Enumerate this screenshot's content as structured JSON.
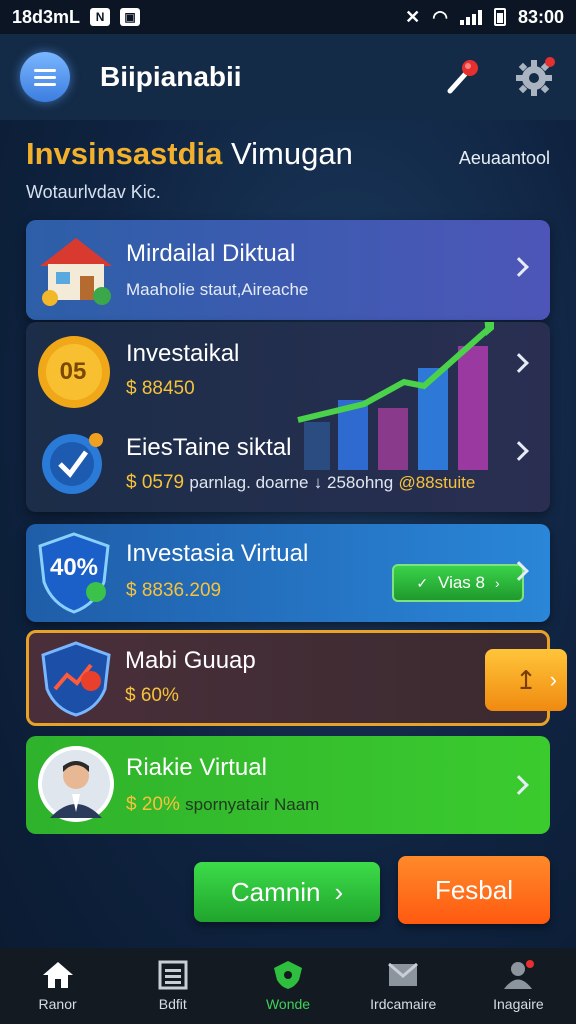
{
  "status_bar": {
    "time_left": "18d3mL",
    "time_right": "83:00"
  },
  "app_bar": {
    "title": "Biipianabii"
  },
  "heading": {
    "title_gold": "Invsinsastdia",
    "title_white": " Vimugan",
    "right_text": "Aeuaantool",
    "subtitle": "Wotaurlvdav Kic."
  },
  "cards": [
    {
      "title": "Mirdailal Diktual",
      "subtitle": "Maaholie staut,Aireache"
    },
    {
      "title": "Investaikal",
      "amount": "$ 88450",
      "coin_label": "05"
    },
    {
      "title": "EiesTaine siktal",
      "amount": "$ 0579",
      "extra": "parnlag. doarne",
      "extra2": "↓ 258ohng",
      "extra3": "@88stuite"
    },
    {
      "title": "Investasia Virtual",
      "amount": "$ 8836.209",
      "badge": "40%",
      "button_label": "Vias 8"
    },
    {
      "title": "Mabi Guuap",
      "amount": "$ 60%",
      "button_symbol": "↥"
    },
    {
      "title": "Riakie Virtual",
      "amount": "$ 20%",
      "extra": "spornyatair Naam"
    }
  ],
  "buttons": {
    "primary": "Camnin",
    "secondary": "Fesbal"
  },
  "bottom_nav": [
    {
      "label": "Ranor"
    },
    {
      "label": "Bdfit"
    },
    {
      "label": "Wonde"
    },
    {
      "label": "Irdcamaire"
    },
    {
      "label": "Inagaire"
    }
  ],
  "colors": {
    "accent_gold": "#f3b02c",
    "active_green": "#3ed05a",
    "orange": "#ff6a1a"
  }
}
